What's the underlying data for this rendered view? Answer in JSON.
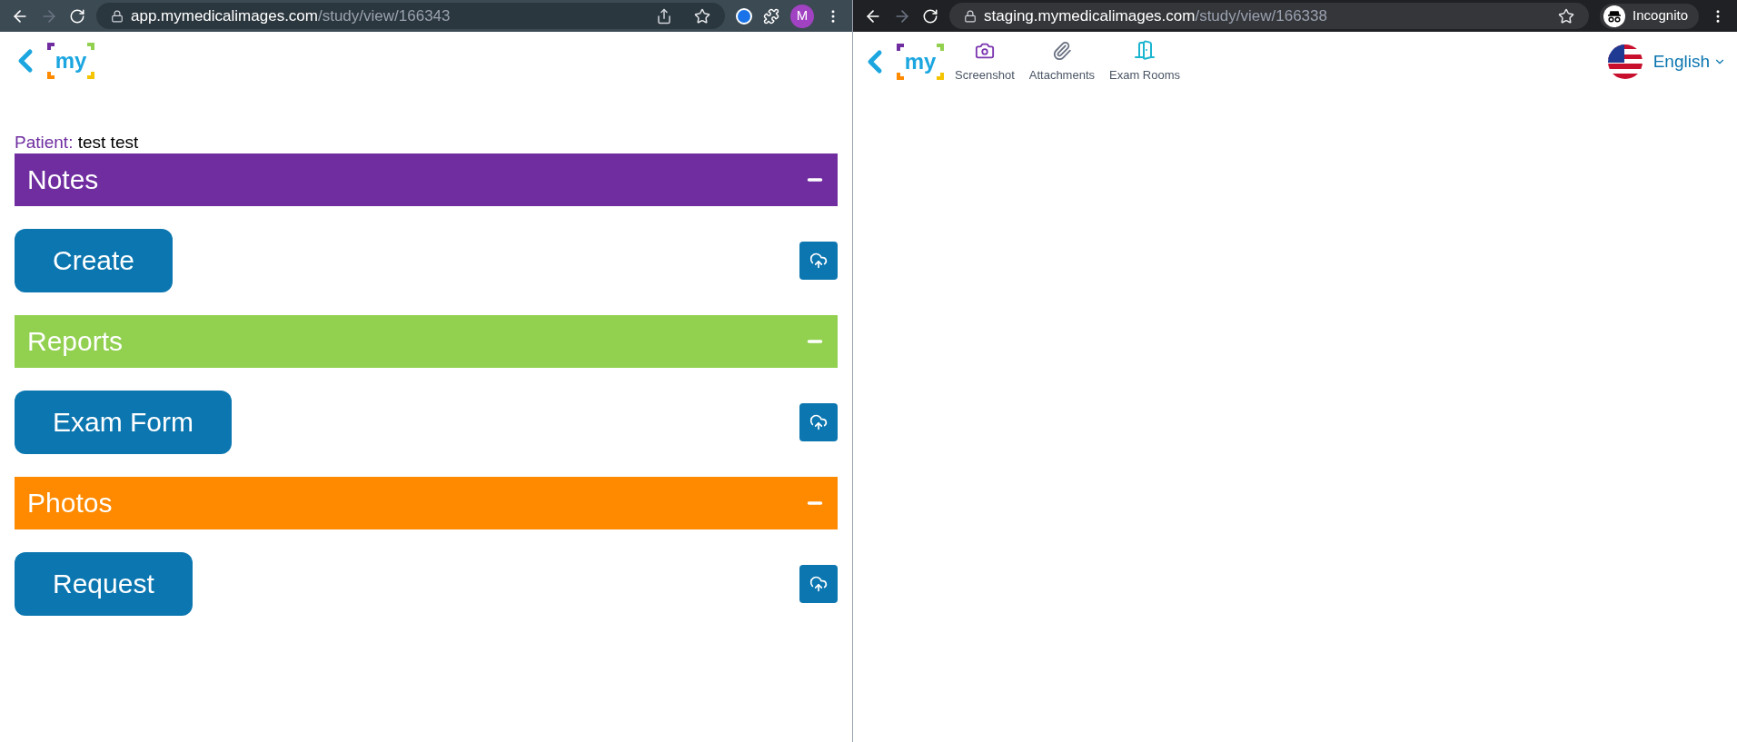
{
  "left_window": {
    "address": {
      "host": "app.mymedicalimages.com",
      "path": "/study/view/166343"
    },
    "profile_initial": "M",
    "logo_text": "my",
    "patient": {
      "label": "Patient:",
      "name": "test test"
    },
    "sections": [
      {
        "title": "Notes",
        "color": "#6f2da0",
        "expanded": true,
        "button": "Create"
      },
      {
        "title": "Reports",
        "color": "#92d050",
        "expanded": true,
        "button": "Exam Form"
      },
      {
        "title": "Photos",
        "color": "#ff8a00",
        "expanded": true,
        "button": "Request"
      }
    ]
  },
  "right_window": {
    "address": {
      "host": "staging.mymedicalimages.com",
      "path": "/study/view/166338"
    },
    "incognito_label": "Incognito",
    "logo_text": "my",
    "toolbar": [
      {
        "label": "Screenshot",
        "kind": "camera"
      },
      {
        "label": "Attachments",
        "kind": "clip"
      },
      {
        "label": "Exam Rooms",
        "kind": "door"
      }
    ],
    "language": "English"
  }
}
